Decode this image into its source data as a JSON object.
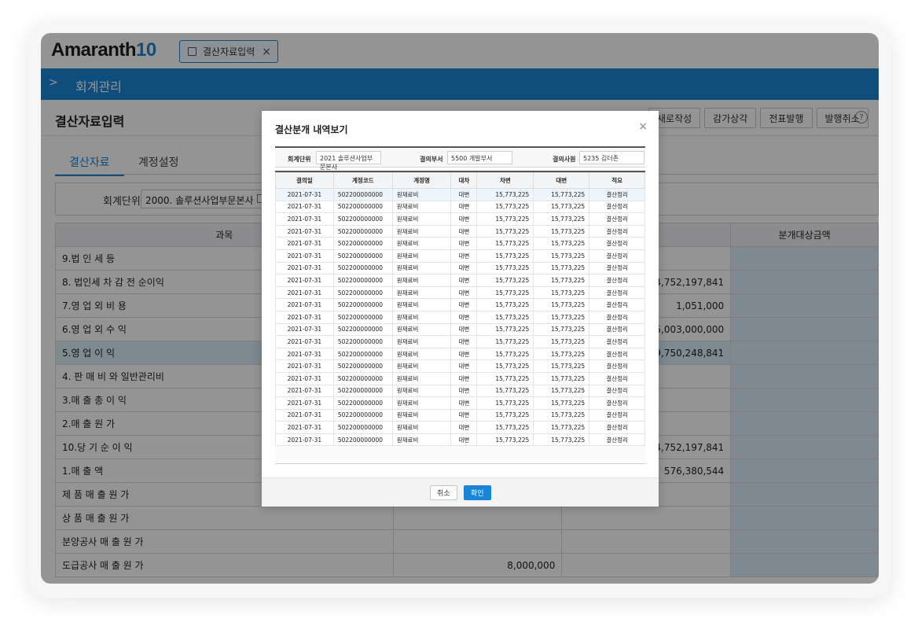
{
  "app": {
    "logo_text": "Amaranth",
    "logo_num": "10",
    "tab_label": "결산자료입력",
    "close_symbol": "×",
    "accent": "#1a85d6"
  },
  "module": {
    "chevron": ">",
    "title": "회계관리"
  },
  "page": {
    "title": "결산자료입력",
    "buttons": [
      "새로작성",
      "감가상각",
      "전표발행",
      "발행취소"
    ],
    "help": "?"
  },
  "tabs": [
    "결산자료",
    "계정설정"
  ],
  "filter": {
    "label": "회계단위",
    "value": "2000. 솔루션사업부문본사"
  },
  "main_table": {
    "headers": [
      "과목",
      "",
      "",
      "분개대상금액"
    ],
    "rows": [
      {
        "label": "9.법  인  세  등",
        "c2": "",
        "c3": "",
        "highlight": false
      },
      {
        "label": "8. 법인세 차 감 전 순이익",
        "c2": "",
        "c3": "14,752,197,841",
        "highlight": false
      },
      {
        "label": "7.영  업  외  비  용",
        "c2": "",
        "c3": "1,051,000",
        "highlight": false
      },
      {
        "label": "6.영  업  외  수  익",
        "c2": "",
        "c3": "5,003,000,000",
        "highlight": false
      },
      {
        "label": "5.영    업    이   익",
        "c2": "",
        "c3": "9,750,248,841",
        "highlight": true
      },
      {
        "label": "4. 판 매 비 와 일반관리비",
        "c2": "",
        "c3": "",
        "highlight": false
      },
      {
        "label": "3.매  출  총  이  익",
        "c2": "",
        "c3": "",
        "highlight": false
      },
      {
        "label": "2.매    출    원    가",
        "c2": "",
        "c3": "",
        "highlight": false
      },
      {
        "label": "10.당  기  순  이  익",
        "c2": "",
        "c3": "14,752,197,841",
        "highlight": false
      },
      {
        "label": "1.매      출      액",
        "c2": "",
        "c3": "576,380,544",
        "highlight": false
      },
      {
        "label": "  제  품  매  출  원  가",
        "c2": "",
        "c3": "",
        "highlight": false
      },
      {
        "label": "  상  품  매  출  원  가",
        "c2": "",
        "c3": "",
        "highlight": false
      },
      {
        "label": "  분양공사  매  출  원  가",
        "c2": "",
        "c3": "",
        "highlight": false
      },
      {
        "label": "  도급공사  매  출  원  가",
        "c2": "8,000,000",
        "c3": "",
        "highlight": false
      }
    ]
  },
  "modal": {
    "title": "결산분개 내역보기",
    "close_symbol": "×",
    "filters": [
      {
        "label": "회계단위",
        "value": "2021 솔루션사업부문본사"
      },
      {
        "label": "결의부서",
        "value": "5500 개발부서"
      },
      {
        "label": "결의사원",
        "value": "5235 김더존"
      }
    ],
    "columns": [
      "결의일",
      "계정코드",
      "계정명",
      "대차",
      "차변",
      "대변",
      "적요"
    ],
    "rows": [
      [
        "2021-07-31",
        "502200000000",
        "원재료비",
        "대변",
        "15,773,225",
        "15,773,225",
        "결산정리"
      ],
      [
        "2021-07-31",
        "502200000000",
        "원재료비",
        "대변",
        "15,773,225",
        "15,773,225",
        "결산정리"
      ],
      [
        "2021-07-31",
        "502200000000",
        "원재료비",
        "대변",
        "15,773,225",
        "15,773,225",
        "결산정리"
      ],
      [
        "2021-07-31",
        "502200000000",
        "원재료비",
        "대변",
        "15,773,225",
        "15,773,225",
        "결산정리"
      ],
      [
        "2021-07-31",
        "502200000000",
        "원재료비",
        "대변",
        "15,773,225",
        "15,773,225",
        "결산정리"
      ],
      [
        "2021-07-31",
        "502200000000",
        "원재료비",
        "대변",
        "15,773,225",
        "15,773,225",
        "결산정리"
      ],
      [
        "2021-07-31",
        "502200000000",
        "원재료비",
        "대변",
        "15,773,225",
        "15,773,225",
        "결산정리"
      ],
      [
        "2021-07-31",
        "502200000000",
        "원재료비",
        "대변",
        "15,773,225",
        "15,773,225",
        "결산정리"
      ],
      [
        "2021-07-31",
        "502200000000",
        "원재료비",
        "대변",
        "15,773,225",
        "15,773,225",
        "결산정리"
      ],
      [
        "2021-07-31",
        "502200000000",
        "원재료비",
        "대변",
        "15,773,225",
        "15,773,225",
        "결산정리"
      ],
      [
        "2021-07-31",
        "502200000000",
        "원재료비",
        "대변",
        "15,773,225",
        "15,773,225",
        "결산정리"
      ],
      [
        "2021-07-31",
        "502200000000",
        "원재료비",
        "대변",
        "15,773,225",
        "15,773,225",
        "결산정리"
      ],
      [
        "2021-07-31",
        "502200000000",
        "원재료비",
        "대변",
        "15,773,225",
        "15,773,225",
        "결산정리"
      ],
      [
        "2021-07-31",
        "502200000000",
        "원재료비",
        "대변",
        "15,773,225",
        "15,773,225",
        "결산정리"
      ],
      [
        "2021-07-31",
        "502200000000",
        "원재료비",
        "대변",
        "15,773,225",
        "15,773,225",
        "결산정리"
      ],
      [
        "2021-07-31",
        "502200000000",
        "원재료비",
        "대변",
        "15,773,225",
        "15,773,225",
        "결산정리"
      ],
      [
        "2021-07-31",
        "502200000000",
        "원재료비",
        "대변",
        "15,773,225",
        "15,773,225",
        "결산정리"
      ],
      [
        "2021-07-31",
        "502200000000",
        "원재료비",
        "대변",
        "15,773,225",
        "15,773,225",
        "결산정리"
      ],
      [
        "2021-07-31",
        "502200000000",
        "원재료비",
        "대변",
        "15,773,225",
        "15,773,225",
        "결산정리"
      ],
      [
        "2021-07-31",
        "502200000000",
        "원재료비",
        "대변",
        "15,773,225",
        "15,773,225",
        "결산정리"
      ],
      [
        "2021-07-31",
        "502200000000",
        "원재료비",
        "대변",
        "15,773,225",
        "15,773,225",
        "결산정리"
      ]
    ],
    "cancel_label": "취소",
    "ok_label": "확인"
  }
}
